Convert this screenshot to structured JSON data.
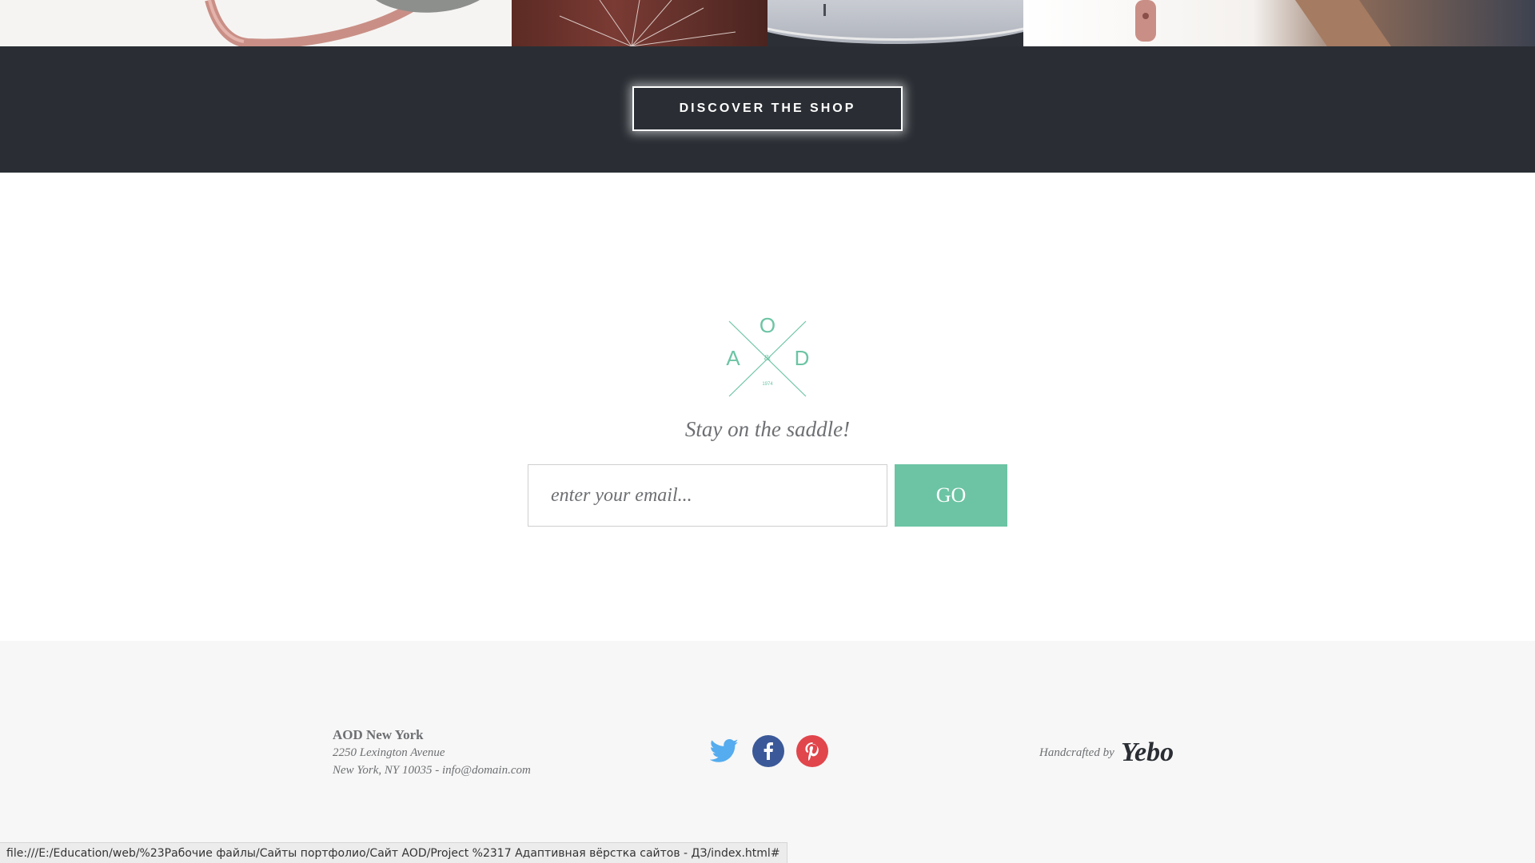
{
  "shop": {
    "button_label": "DISCOVER THE SHOP"
  },
  "newsletter": {
    "logo": {
      "letter_top": "O",
      "letter_left": "A",
      "letter_right": "D",
      "ampersand": "&",
      "year": "1974"
    },
    "tagline": "Stay on the saddle!",
    "email_placeholder": "enter your email...",
    "go_label": "GO"
  },
  "footer": {
    "company": "AOD New York",
    "address_line1": "2250 Lexington Avenue",
    "address_line2": "New York, NY 10035 - info@domain.com",
    "social": [
      "twitter-icon",
      "facebook-icon",
      "pinterest-icon"
    ],
    "handcrafted_label": "Handcrafted by",
    "handcrafted_brand": "Yebo"
  },
  "colors": {
    "dark_band": "#2a2e34",
    "accent_green": "#6cc4a4",
    "twitter": "#55acee",
    "facebook": "#3b5998",
    "pinterest": "#e0464c"
  },
  "statusbar": {
    "url": "file:///E:/Education/web/%23Рабочие файлы/Сайты портфолио/Сайт AOD/Project %2317 Адаптивная вёрстка сайтов - ДЗ/index.html#"
  }
}
